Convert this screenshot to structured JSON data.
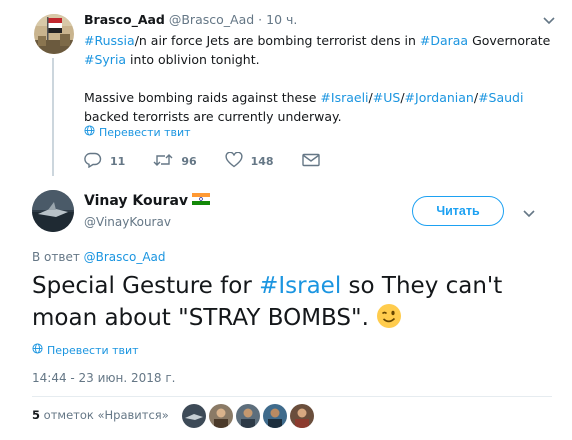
{
  "parent_tweet": {
    "author_name": "Brasco_Aad",
    "author_handle": "@Brasco_Aad",
    "time_sep": "·",
    "time": "10 ч.",
    "text_lines": {
      "l1": [
        {
          "t": "#Russia",
          "link": true
        },
        {
          "t": "/n air force Jets are bombing terrorist dens in ",
          "link": false
        },
        {
          "t": "#Daraa",
          "link": true
        },
        {
          "t": " Governorate",
          "link": false
        }
      ],
      "l2": [
        {
          "t": "#Syria",
          "link": true
        },
        {
          "t": " into oblivion tonight.",
          "link": false
        }
      ],
      "l3": [
        {
          "t": "Massive bombing raids against these ",
          "link": false
        },
        {
          "t": "#Israeli",
          "link": true
        },
        {
          "t": "/",
          "link": false
        },
        {
          "t": "#US",
          "link": true
        },
        {
          "t": "/",
          "link": false
        },
        {
          "t": "#Jordanian",
          "link": true
        },
        {
          "t": "/",
          "link": false
        },
        {
          "t": "#Saudi",
          "link": true
        }
      ],
      "l4": [
        {
          "t": "backed terorrists are currently underway.",
          "link": false
        }
      ]
    },
    "translate_label": "Перевести твит",
    "replies": "11",
    "retweets": "96",
    "likes": "148"
  },
  "main_tweet": {
    "author_name": "Vinay Kourav",
    "author_handle": "@VinayKourav",
    "follow_label": "Читать",
    "reply_prefix": "В ответ ",
    "reply_handle": "@Brasco_Aad",
    "text_lines": {
      "l1": [
        {
          "t": "Special Gesture for ",
          "link": false
        },
        {
          "t": "#Israel",
          "link": true
        },
        {
          "t": " so They can't",
          "link": false
        }
      ],
      "l2": [
        {
          "t": "moan about \"STRAY BOMBS\". ",
          "link": false
        }
      ]
    },
    "translate_label": "Перевести твит",
    "timestamp": "14:44 - 23 июн. 2018 г.",
    "likes_count": "5",
    "likes_label": " отметок «Нравится»"
  },
  "colors": {
    "link": "#1b95e0",
    "text": "#14171a",
    "secondary": "#657786",
    "follow_border": "#1da1f2"
  },
  "icons": {
    "reply": "reply-icon",
    "retweet": "retweet-icon",
    "like": "heart-icon",
    "dm": "envelope-icon",
    "globe": "globe-icon",
    "chevron": "chevron-down-icon",
    "flag": "india-flag-icon",
    "emoji": "winking-face-icon"
  }
}
